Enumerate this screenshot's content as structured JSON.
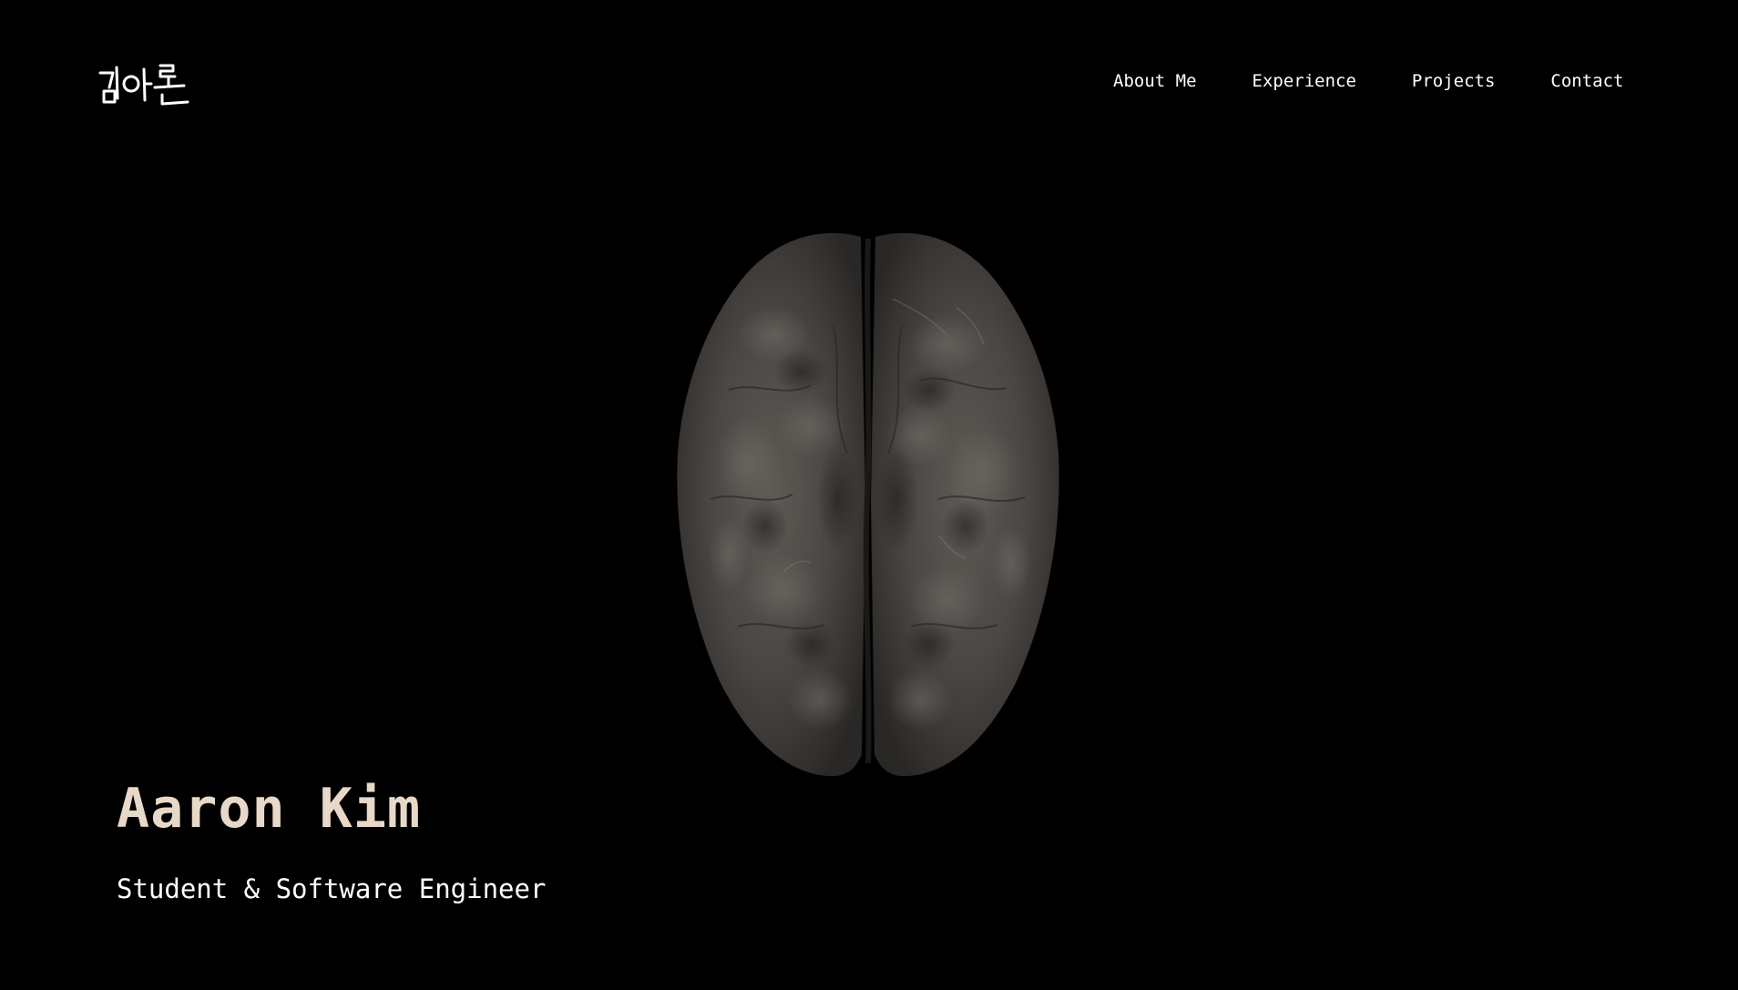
{
  "header": {
    "logo_text": "김아론",
    "nav": [
      {
        "label": "About Me"
      },
      {
        "label": "Experience"
      },
      {
        "label": "Projects"
      },
      {
        "label": "Contact"
      }
    ]
  },
  "hero": {
    "name": "Aaron Kim",
    "subtitle": "Student & Software Engineer"
  },
  "colors": {
    "background": "#000000",
    "name": "#e8d8c8",
    "text": "#ffffff",
    "brain_base": "#4a4744",
    "brain_highlight": "#6e6964"
  },
  "icons": {
    "logo": "handwritten-korean-name-logo",
    "hero_visual": "brain-3d-model"
  }
}
